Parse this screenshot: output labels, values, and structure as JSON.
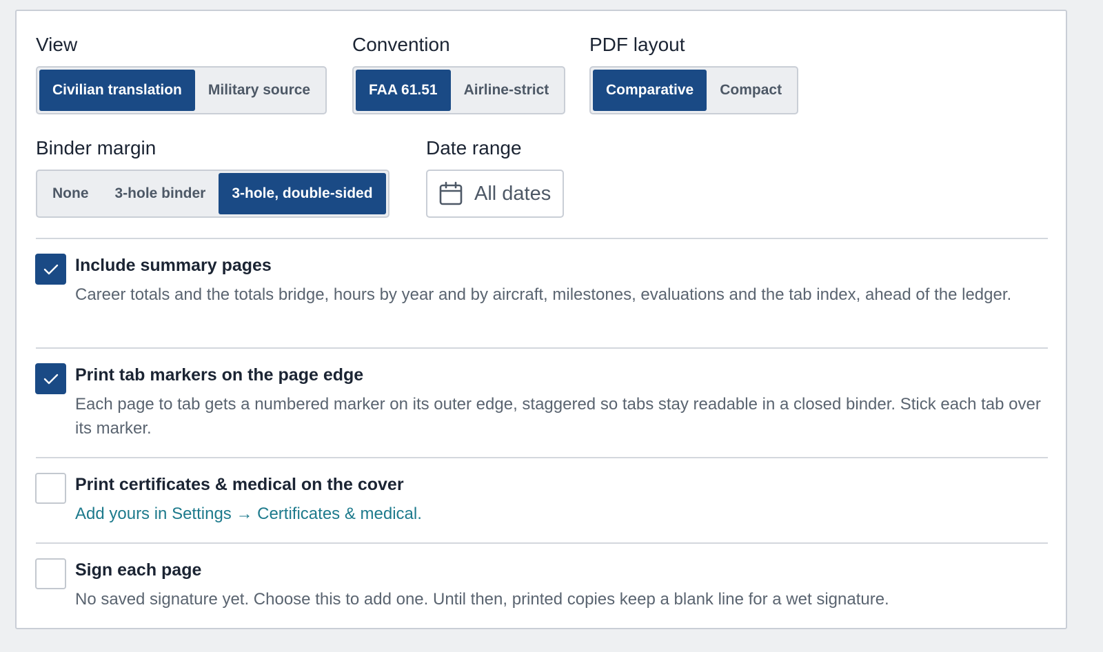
{
  "view": {
    "label": "View",
    "options": [
      "Civilian translation",
      "Military source"
    ],
    "selected": "Civilian translation"
  },
  "convention": {
    "label": "Convention",
    "options": [
      "FAA 61.51",
      "Airline-strict"
    ],
    "selected": "FAA 61.51"
  },
  "pdf_layout": {
    "label": "PDF layout",
    "options": [
      "Comparative",
      "Compact"
    ],
    "selected": "Comparative"
  },
  "binder_margin": {
    "label": "Binder margin",
    "options": [
      "None",
      "3-hole binder",
      "3-hole, double-sided"
    ],
    "selected": "3-hole, double-sided"
  },
  "date_range": {
    "label": "Date range",
    "value": "All dates",
    "icon": "calendar-icon"
  },
  "options": [
    {
      "title": "Include summary pages",
      "checked": true,
      "description": "Career totals and the totals bridge, hours by year and by aircraft, milestones, evaluations and the tab index, ahead of the ledger."
    },
    {
      "title": "Print tab markers on the page edge",
      "checked": true,
      "description": "Each page to tab gets a numbered marker on its outer edge, staggered so tabs stay readable in a closed binder. Stick each tab over its marker."
    },
    {
      "title": "Print certificates & medical on the cover",
      "checked": false,
      "link": "Add yours in Settings → Certificates & medical."
    },
    {
      "title": "Sign each page",
      "checked": false,
      "description": "No saved signature yet. Choose this to add one. Until then, printed copies keep a blank line for a wet signature."
    }
  ],
  "colors": {
    "accent": "#1a4a85",
    "link": "#1d7a8c",
    "muted_text": "#5a6470",
    "border": "#c9ced6"
  }
}
